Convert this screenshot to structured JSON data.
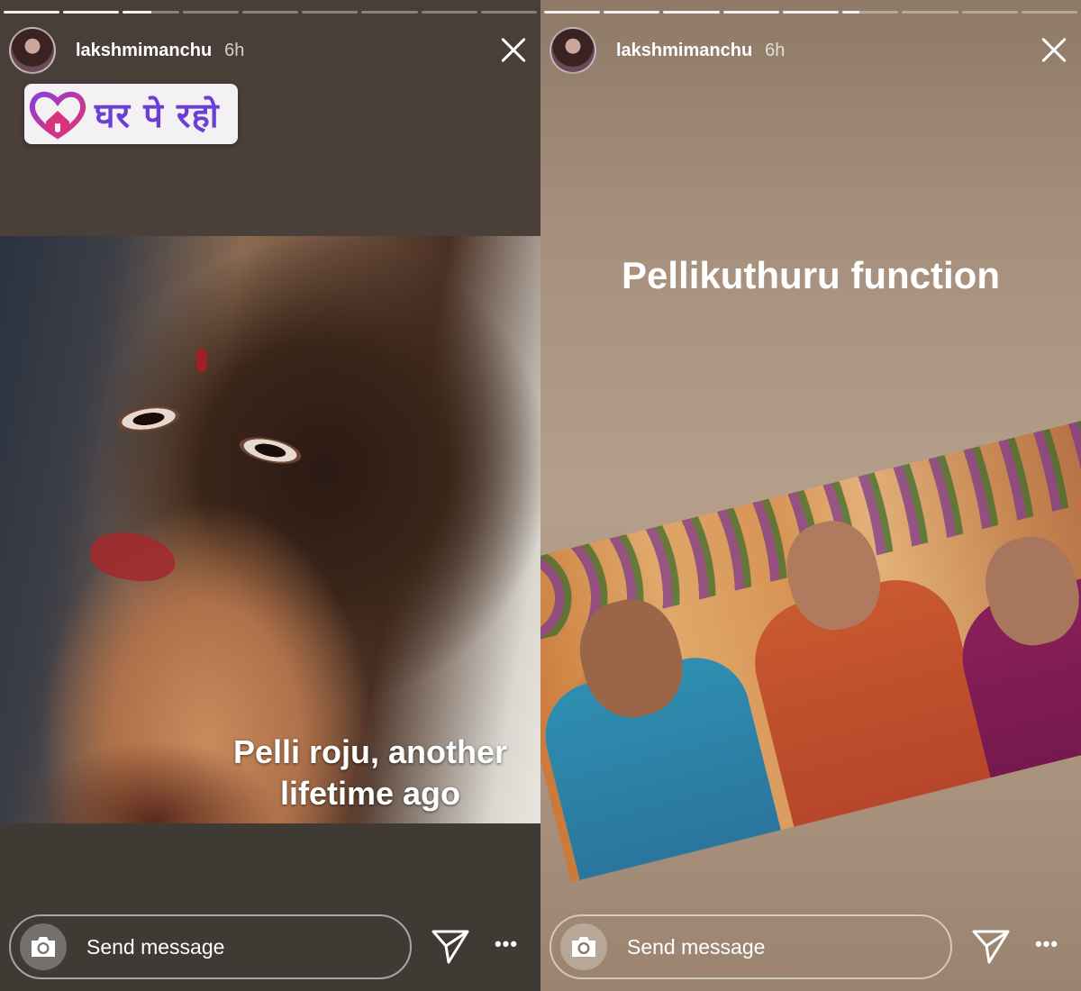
{
  "stories": [
    {
      "progress": [
        1,
        1,
        0.5,
        0,
        0,
        0,
        0,
        0,
        0
      ],
      "username": "lakshmimanchu",
      "time": "6h",
      "sticker_text": "घर पे रहो",
      "caption_line1": "Pelli roju, another",
      "caption_line2": "lifetime ago",
      "message_placeholder": "Send message"
    },
    {
      "progress": [
        1,
        1,
        1,
        1,
        1,
        0.3,
        0,
        0,
        0
      ],
      "username": "lakshmimanchu",
      "time": "6h",
      "title": "Pellikuthuru function",
      "message_placeholder": "Send message"
    }
  ],
  "icons": {
    "close": "close-icon",
    "camera": "camera-icon",
    "send": "paper-plane-icon",
    "more": "more-icon",
    "sticker": "heart-house-icon"
  },
  "colors": {
    "sticker_text": "#6b3fd3",
    "sticker_icon": "#d6337a"
  }
}
